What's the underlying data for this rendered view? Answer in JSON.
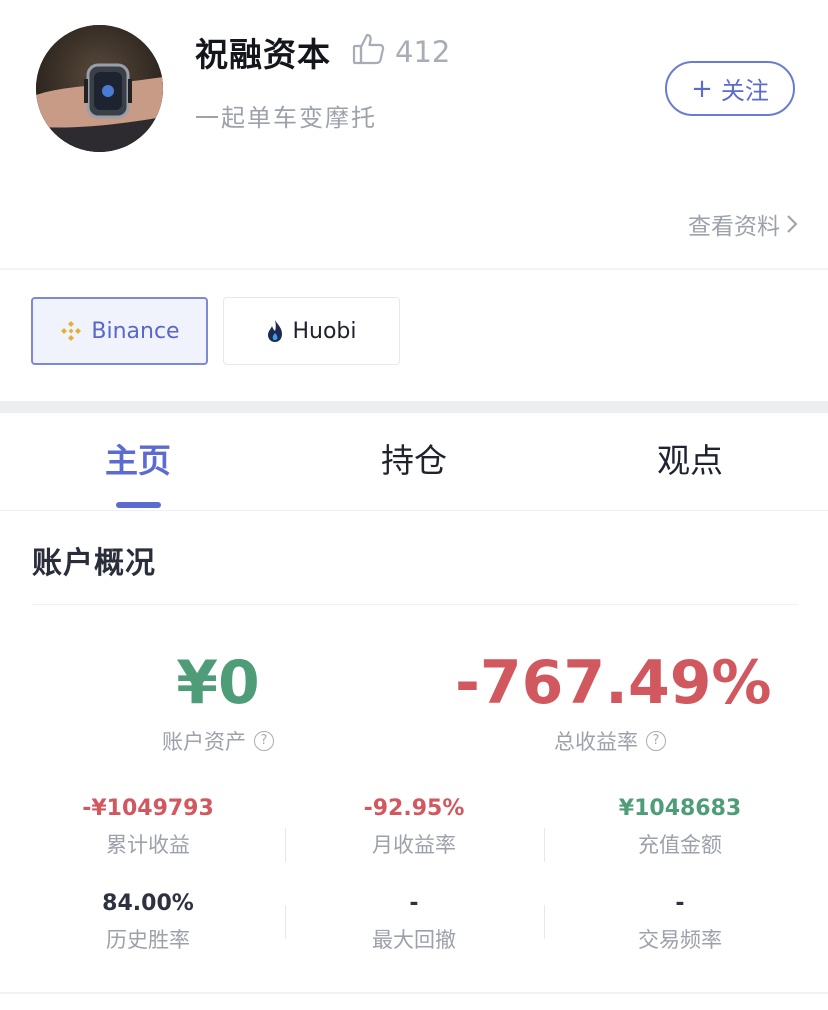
{
  "profile": {
    "name": "祝融资本",
    "like_count": "412",
    "motto": "一起单车变摩托",
    "follow_button": "关注",
    "view_profile": "查看资料"
  },
  "exchanges": [
    {
      "label": "Binance",
      "selected": true
    },
    {
      "label": "Huobi",
      "selected": false
    }
  ],
  "tabs": [
    {
      "label": "主页",
      "active": true
    },
    {
      "label": "持仓",
      "active": false
    },
    {
      "label": "观点",
      "active": false
    }
  ],
  "overview": {
    "title": "账户概况",
    "account_assets": {
      "value": "¥0",
      "label": "账户资产"
    },
    "total_return": {
      "value": "-767.49%",
      "label": "总收益率"
    },
    "stats": [
      {
        "value": "-¥1049793",
        "label": "累计收益"
      },
      {
        "value": "-92.95%",
        "label": "月收益率"
      },
      {
        "value": "¥1048683",
        "label": "充值金额"
      },
      {
        "value": "84.00%",
        "label": "历史胜率"
      },
      {
        "value": "-",
        "label": "最大回撤"
      },
      {
        "value": "-",
        "label": "交易频率"
      }
    ]
  },
  "colors": {
    "accent": "#5b6bd0",
    "positive": "#4f9d78",
    "negative": "#d2585f",
    "muted_text": "#9da1ab"
  }
}
